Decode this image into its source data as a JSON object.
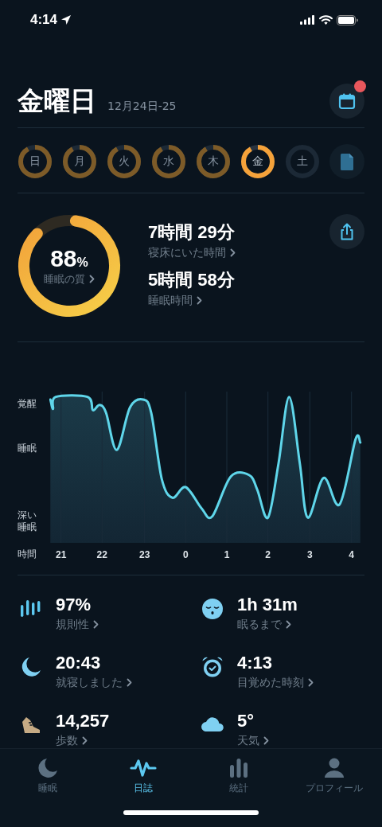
{
  "status_bar": {
    "time": "4:14"
  },
  "header": {
    "title": "金曜日",
    "date": "12月24日-25",
    "notification": true
  },
  "days": [
    {
      "label": "日",
      "kind": "scored",
      "selected": false
    },
    {
      "label": "月",
      "kind": "scored",
      "selected": false
    },
    {
      "label": "火",
      "kind": "scored",
      "selected": false
    },
    {
      "label": "水",
      "kind": "scored",
      "selected": false
    },
    {
      "label": "木",
      "kind": "scored",
      "selected": false
    },
    {
      "label": "金",
      "kind": "scored",
      "selected": true
    },
    {
      "label": "土",
      "kind": "empty",
      "selected": false
    }
  ],
  "summary": {
    "quality": {
      "value": "88",
      "unit": "%",
      "label": "睡眠の質",
      "level": 0.88
    },
    "stats": [
      {
        "value": "7時間 29分",
        "label": "寝床にいた時間"
      },
      {
        "value": "5時間 58分",
        "label": "睡眠時間"
      }
    ]
  },
  "graph": {
    "levels": [
      "覚醒",
      "睡眠",
      "深い睡眠"
    ],
    "axis_label": "時間",
    "hours": [
      "21",
      "22",
      "23",
      "0",
      "1",
      "2",
      "3",
      "4"
    ]
  },
  "metrics": [
    {
      "kind": "regularity",
      "value": "97%",
      "label": "規則性"
    },
    {
      "kind": "latency",
      "value": "1h 31m",
      "label": "眠るまで"
    },
    {
      "kind": "bedtime",
      "value": "20:43",
      "label": "就寝しました"
    },
    {
      "kind": "wake",
      "value": "4:13",
      "label": "目覚めた時刻"
    },
    {
      "kind": "steps",
      "value": "14,257",
      "label": "歩数"
    },
    {
      "kind": "weather",
      "value": "5°",
      "label": "天気"
    }
  ],
  "tabs": [
    {
      "kind": "sleep",
      "label": "睡眠",
      "selected": false
    },
    {
      "kind": "journal",
      "label": "日誌",
      "selected": true
    },
    {
      "kind": "stats",
      "label": "統計",
      "selected": false
    },
    {
      "kind": "profile",
      "label": "プロフィール",
      "selected": false
    }
  ]
}
